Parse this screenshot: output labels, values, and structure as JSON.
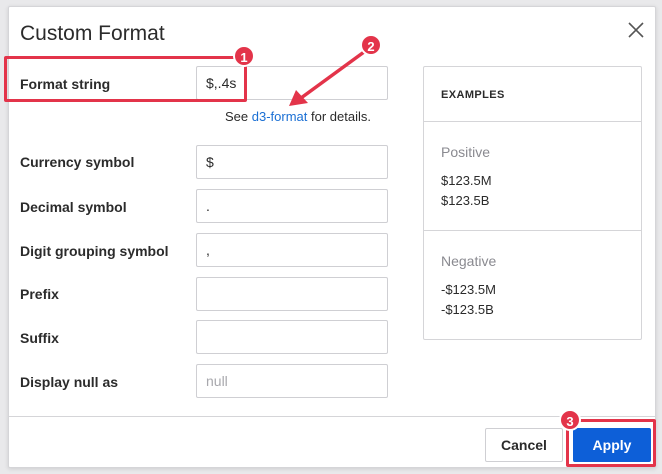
{
  "dialog": {
    "title": "Custom Format",
    "close_icon": "close-icon"
  },
  "form": {
    "format_string": {
      "label": "Format string",
      "value": "$,.4s"
    },
    "help": {
      "prefix": "See ",
      "link": "d3-format",
      "suffix": " for details."
    },
    "currency_symbol": {
      "label": "Currency symbol",
      "value": "$"
    },
    "decimal_symbol": {
      "label": "Decimal symbol",
      "value": "."
    },
    "digit_grouping_symbol": {
      "label": "Digit grouping symbol",
      "value": ","
    },
    "prefix": {
      "label": "Prefix",
      "value": ""
    },
    "suffix": {
      "label": "Suffix",
      "value": ""
    },
    "display_null_as": {
      "label": "Display null as",
      "value": "",
      "placeholder": "null"
    }
  },
  "examples": {
    "header": "EXAMPLES",
    "positive": {
      "title": "Positive",
      "values": [
        "$123.5M",
        "$123.5B"
      ]
    },
    "negative": {
      "title": "Negative",
      "values": [
        "-$123.5M",
        "-$123.5B"
      ]
    }
  },
  "footer": {
    "cancel_label": "Cancel",
    "apply_label": "Apply"
  },
  "annotations": {
    "badge_1": "1",
    "badge_2": "2",
    "badge_3": "3",
    "color": "#e3344a"
  },
  "colors": {
    "primary": "#0d5fd8",
    "link": "#1a6fd4"
  }
}
